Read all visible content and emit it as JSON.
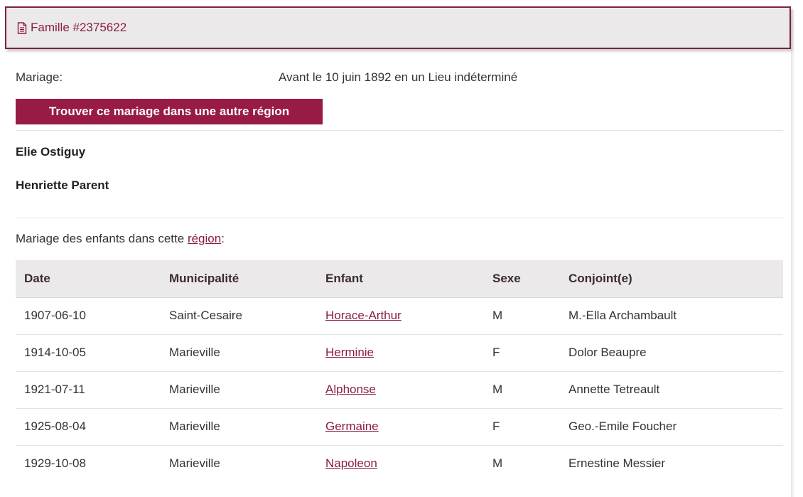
{
  "header": {
    "title": "Famille #2375622",
    "icon": "document-icon"
  },
  "marriage": {
    "label": "Mariage:",
    "value": "Avant le 10 juin 1892 en un Lieu indéterminé",
    "button_label": "Trouver ce mariage dans une autre région"
  },
  "spouses": [
    "Elie Ostiguy",
    "Henriette Parent"
  ],
  "children_section": {
    "prefix": "Mariage des enfants dans cette ",
    "link": "région",
    "suffix": ":"
  },
  "table": {
    "columns": [
      "Date",
      "Municipalité",
      "Enfant",
      "Sexe",
      "Conjoint(e)"
    ],
    "rows": [
      {
        "date": "1907-06-10",
        "municipality": "Saint-Cesaire",
        "child": "Horace-Arthur",
        "sex": "M",
        "spouse": "M.-Ella Archambault"
      },
      {
        "date": "1914-10-05",
        "municipality": "Marieville",
        "child": "Herminie",
        "sex": "F",
        "spouse": "Dolor Beaupre"
      },
      {
        "date": "1921-07-11",
        "municipality": "Marieville",
        "child": "Alphonse",
        "sex": "M",
        "spouse": "Annette Tetreault"
      },
      {
        "date": "1925-08-04",
        "municipality": "Marieville",
        "child": "Germaine",
        "sex": "F",
        "spouse": "Geo.-Emile Foucher"
      },
      {
        "date": "1929-10-08",
        "municipality": "Marieville",
        "child": "Napoleon",
        "sex": "M",
        "spouse": "Ernestine Messier"
      }
    ]
  },
  "colors": {
    "brand": "#971b45",
    "link": "#8b1d44",
    "header_bg": "#ebe9ea"
  }
}
